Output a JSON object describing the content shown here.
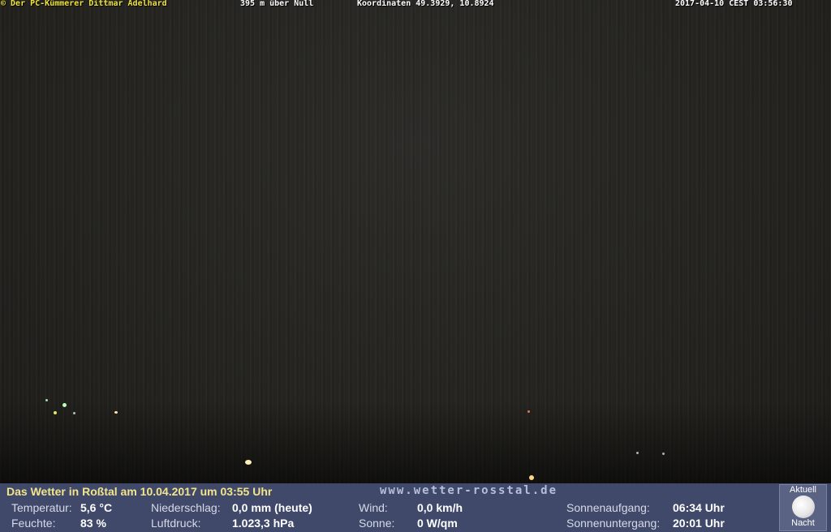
{
  "overlay": {
    "copyright": "© Der PC-Kümmerer Dittmar Adelhard",
    "altitude": "395 m über Null",
    "coordinates": "Koordinaten 49.3929, 10.8924",
    "timestamp": "2017-04-10 CEST 03:56:30"
  },
  "weather": {
    "headline": "Das Wetter in Roßtal am 10.04.2017 um 03:55 Uhr",
    "website": "www.wetter-rosstal.de",
    "temperature_label": "Temperatur:",
    "temperature_value": "5,6 °C",
    "humidity_label": "Feuchte:",
    "humidity_value": "83 %",
    "precip_label": "Niederschlag:",
    "precip_value": "0,0 mm (heute)",
    "pressure_label": "Luftdruck:",
    "pressure_value": "1.023,3 hPa",
    "wind_label": "Wind:",
    "wind_value": "0,0 km/h",
    "sun_label": "Sonne:",
    "sun_value": "0 W/qm",
    "sunrise_label": "Sonnenaufgang:",
    "sunrise_value": "06:34 Uhr",
    "sunset_label": "Sonnenuntergang:",
    "sunset_value": "20:01 Uhr",
    "moon_top": "Aktuell",
    "moon_bottom": "Nacht"
  },
  "colors": {
    "overlay_text": "#f0e33a",
    "panel_bg": "#41496b",
    "headline": "#f2e48a"
  }
}
